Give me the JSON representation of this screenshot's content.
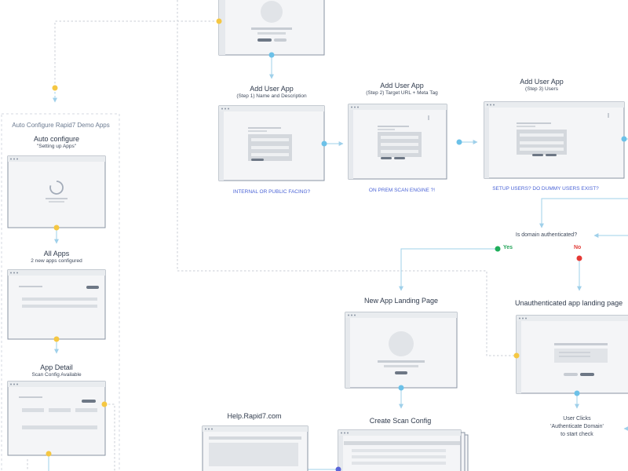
{
  "colors": {
    "connector": "#9fd0ea",
    "dashed": "#c9ced6",
    "dot_yellow": "#f5c742",
    "dot_blue": "#6cc1e8",
    "dot_green": "#1fae5b",
    "dot_red": "#e53935",
    "dot_purple": "#5b66d9",
    "label_blue": "#4a63d6"
  },
  "lane": {
    "title": "Auto Configure Rapid7 Demo Apps",
    "auto_configure_title": "Auto configure",
    "auto_configure_sub": "\"Setting up Apps\"",
    "all_apps_title": "All Apps",
    "all_apps_sub": "2 new apps configured",
    "app_detail_title": "App Detail",
    "app_detail_sub": "Scan Config Available"
  },
  "steps": {
    "step1_title": "Add User App",
    "step1_sub": "(Step 1) Name and Description",
    "step1_question": "INTERNAL OR PUBLIC FACING?",
    "step2_title": "Add User App",
    "step2_sub": "(Step 2) Target URL + Meta Tag",
    "step2_question": "ON PREM SCAN ENGINE ?!",
    "step3_title": "Add User App",
    "step3_sub": "(Step 3) Users",
    "step3_question": "SETUP USERS? DO DUMMY USERS EXIST?"
  },
  "decision": {
    "question": "Is domain authenticated?",
    "yes": "Yes",
    "no": "No"
  },
  "pages": {
    "new_app_landing": "New App  Landing Page",
    "unauth_landing": "Unauthenticated app landing page",
    "create_scan_config": "Create Scan Config",
    "help": "Help.Rapid7.com"
  },
  "user_clicks": {
    "line1": "User Clicks",
    "line2": "'Authenticate Domain'",
    "line3": "to start check"
  }
}
